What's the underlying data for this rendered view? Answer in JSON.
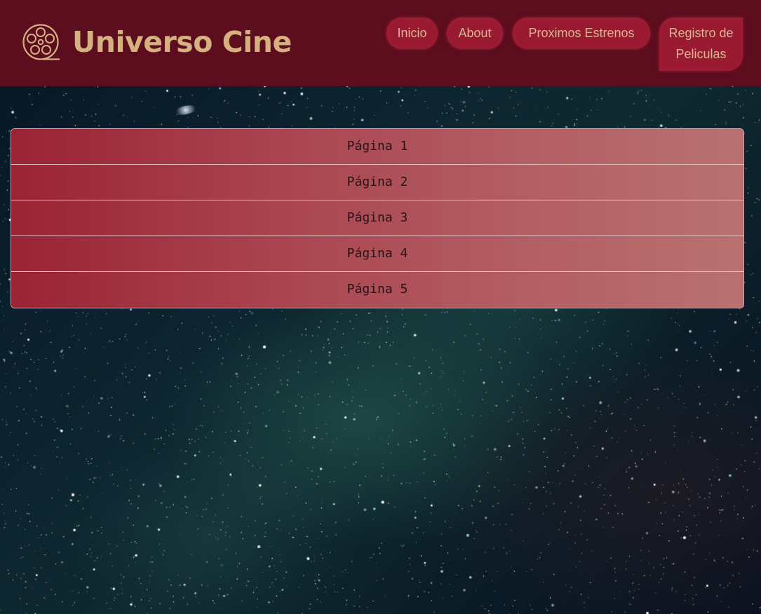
{
  "header": {
    "brand": "Universo Cine",
    "logo_icon": "film-reel-icon",
    "colors": {
      "header_bg": "#5c0d1e",
      "accent": "#d4b17f",
      "nav_button_bg": "#9a1a32"
    }
  },
  "nav": {
    "items": [
      {
        "label": "Inicio"
      },
      {
        "label": "About"
      },
      {
        "label": "Proximos Estrenos"
      },
      {
        "label_line1": "Registro de",
        "label_line2": "Peliculas"
      }
    ]
  },
  "pagination": {
    "pages": [
      {
        "label": "Página 1"
      },
      {
        "label": "Página 2"
      },
      {
        "label": "Página 3"
      },
      {
        "label": "Página 4"
      },
      {
        "label": "Página 5"
      }
    ]
  },
  "background": {
    "description_icon": "starfield-background"
  }
}
